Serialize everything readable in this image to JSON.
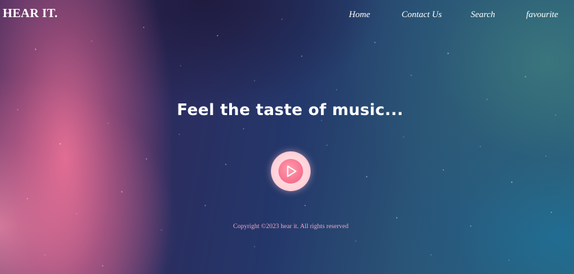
{
  "header": {
    "logo": "HEAR IT.",
    "nav": [
      "Home",
      "Contact Us",
      "Search",
      "favourite"
    ]
  },
  "hero": {
    "headline": "Feel the taste of music...",
    "play_icon": "play-icon"
  },
  "footer": {
    "copyright": "Copyright ©2023 hear it. All rights reserved"
  },
  "colors": {
    "accent_pink": "#f66f8c",
    "play_ring": "#ffd3da",
    "copyright_text": "#e9a9c4"
  }
}
